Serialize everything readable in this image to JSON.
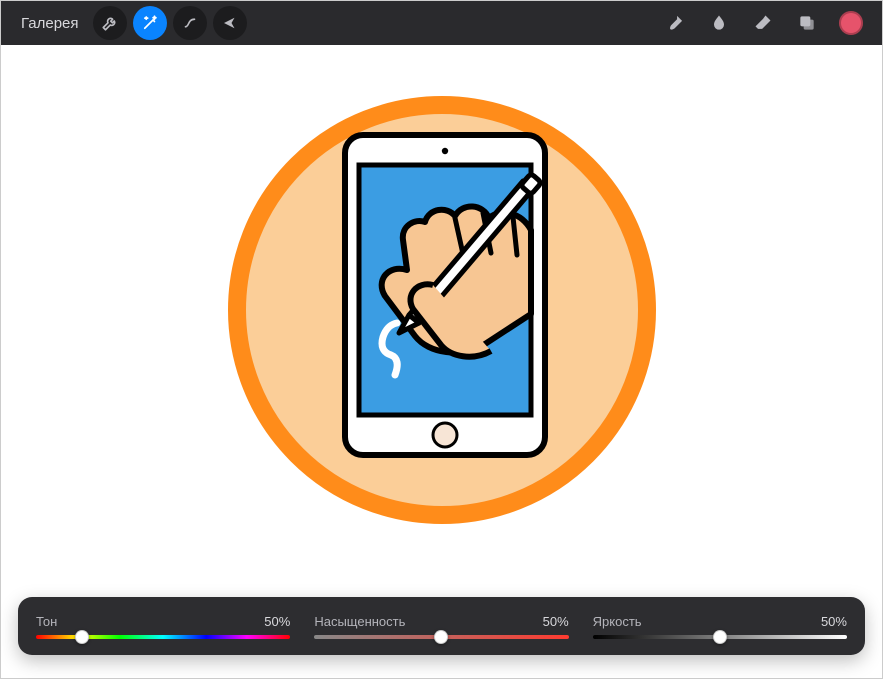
{
  "topbar": {
    "gallery_label": "Галерея"
  },
  "sliders": {
    "hue": {
      "label": "Тон",
      "value": "50%",
      "pos": 18
    },
    "saturation": {
      "label": "Насыщенность",
      "value": "50%",
      "pos": 50
    },
    "brightness": {
      "label": "Яркость",
      "value": "50%",
      "pos": 50
    }
  },
  "colors": {
    "swatch": "#e6536b"
  }
}
